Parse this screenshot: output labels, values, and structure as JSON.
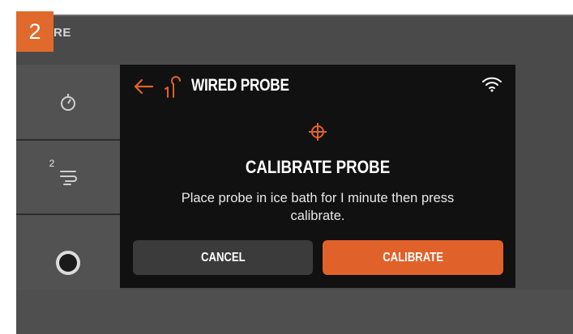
{
  "tutorial": {
    "step_number": "2"
  },
  "background_screen": {
    "title_partial": "RE",
    "probe_slot_number": "2"
  },
  "sidebar": {
    "items": [
      {
        "icon": "timer-icon"
      },
      {
        "icon": "smoke-icon"
      },
      {
        "icon": "probe-jack-icon"
      }
    ]
  },
  "dialog": {
    "header": {
      "title": "WIRED PROBE",
      "probe_icon": "wired-probe-1-icon",
      "status_icon": "wifi-icon"
    },
    "icon": "crosshair-icon",
    "heading": "CALIBRATE PROBE",
    "message": "Place probe in ice bath for I minute then press calibrate.",
    "buttons": {
      "cancel": "CANCEL",
      "calibrate": "CALIBRATE"
    }
  },
  "colors": {
    "accent": "#e0622a",
    "dialog_bg": "#111111",
    "screen_bg": "#4a4a4a",
    "sidebar_bg": "#525252",
    "cancel_bg": "#3b3b3b"
  }
}
